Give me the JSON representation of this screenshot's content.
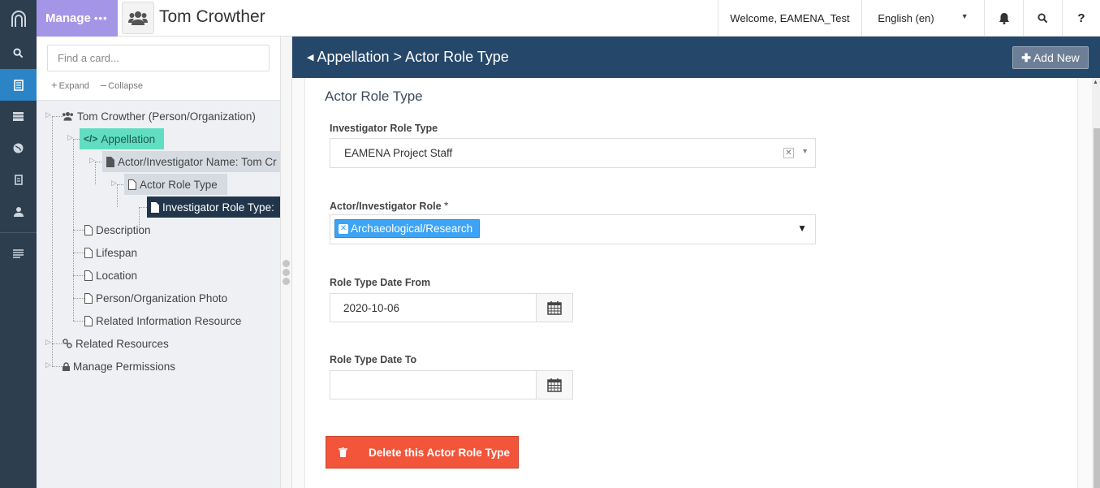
{
  "topbar": {
    "manage_label": "Manage",
    "manage_dots": "•••",
    "resource_title": "Tom Crowther",
    "welcome": "Welcome, EAMENA_Test",
    "language": "English (en)",
    "help_glyph": "?"
  },
  "rail": {
    "icons": [
      "arches-logo-icon",
      "search-icon",
      "resource-editor-icon",
      "list-icon",
      "globe-icon",
      "document-icon",
      "user-icon",
      "menu-icon"
    ],
    "accent": "#2b84c6"
  },
  "tree_panel": {
    "search_placeholder": "Find a card...",
    "expand_label": "Expand",
    "collapse_label": "Collapse",
    "nodes": {
      "root": "Tom Crowther (Person/Organization)",
      "appellation": "Appellation",
      "actor_name": "Actor/Investigator Name: Tom Cr",
      "actor_role_type": "Actor Role Type",
      "investigator_role_type": "Investigator Role Type:",
      "description": "Description",
      "lifespan": "Lifespan",
      "location": "Location",
      "photo": "Person/Organization Photo",
      "related_info": "Related Information Resource",
      "related_resources": "Related Resources",
      "permissions": "Manage Permissions"
    }
  },
  "main": {
    "breadcrumb": "Appellation > Actor Role Type",
    "add_new_label": "Add New",
    "card_title": "Actor Role Type",
    "fields": {
      "investigator_role_type": {
        "label": "Investigator Role Type",
        "value": "EAMENA Project Staff"
      },
      "actor_role": {
        "label": "Actor/Investigator Role",
        "required_mark": "*",
        "tag": "Archaeological/Research"
      },
      "date_from": {
        "label": "Role Type Date From",
        "value": "2020-10-06"
      },
      "date_to": {
        "label": "Role Type Date To",
        "value": ""
      }
    },
    "delete_label": "Delete this Actor Role Type"
  },
  "colors": {
    "manage_purple": "#a595e6",
    "header_navy": "#25476a",
    "selected_green": "#61ddc1",
    "selected_dark": "#22364b",
    "tag_blue": "#3da3f5",
    "delete_red": "#f2553a"
  }
}
